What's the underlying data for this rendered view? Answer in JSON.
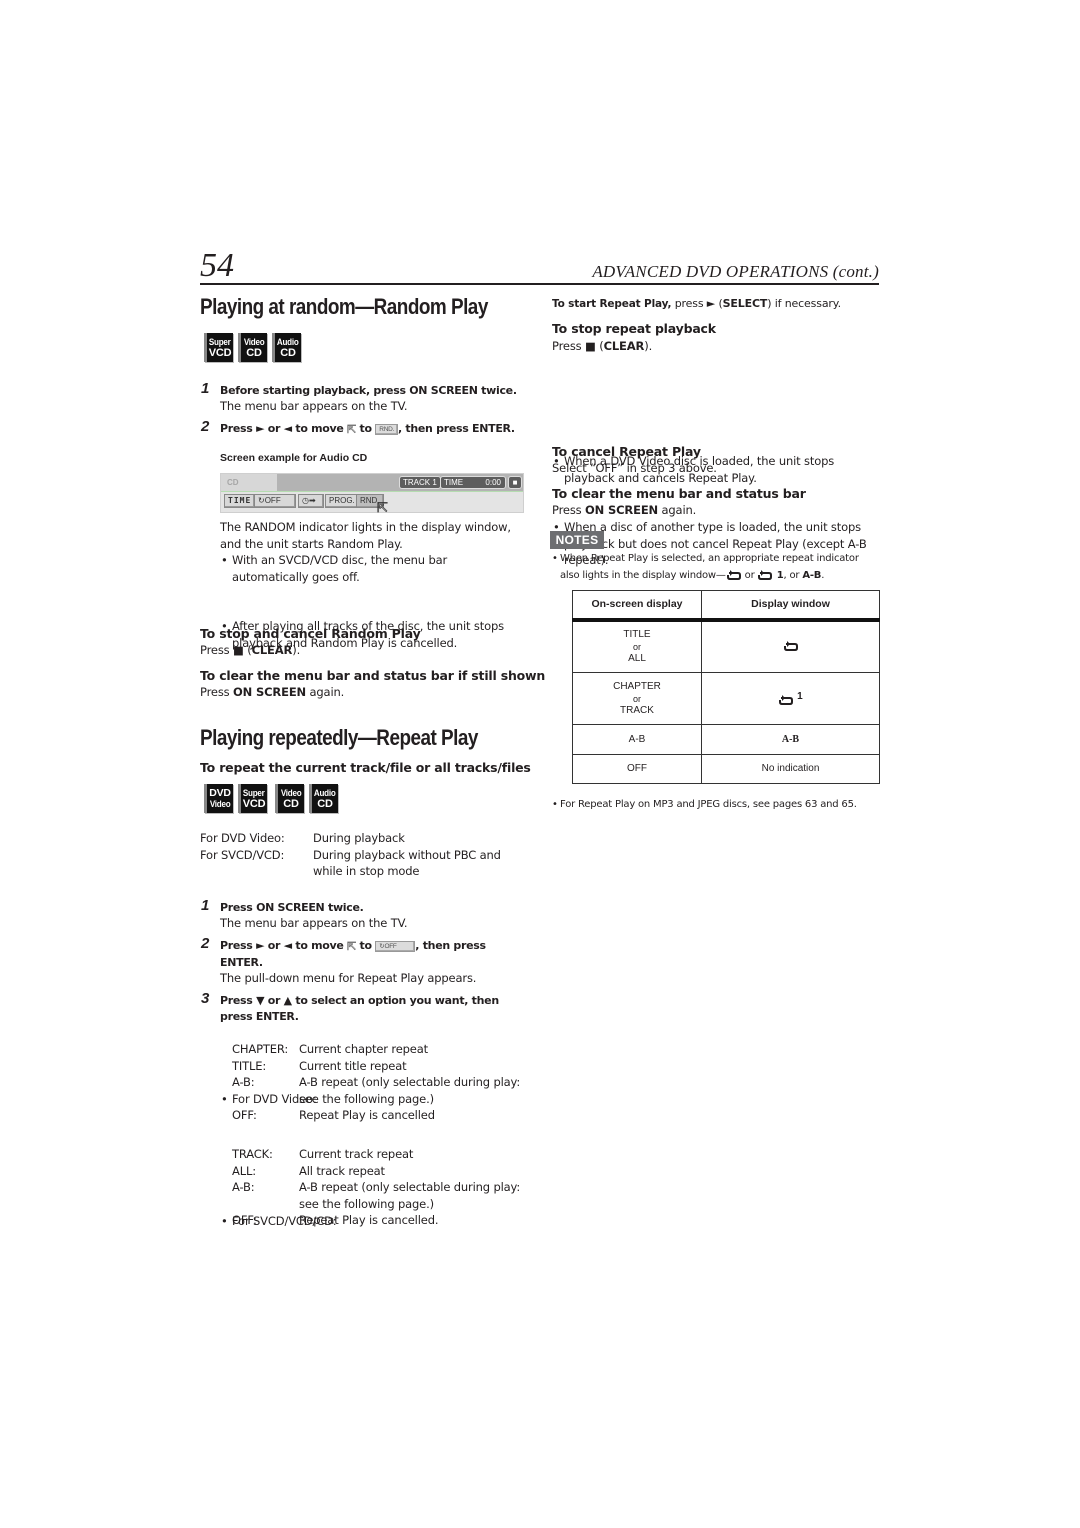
{
  "header": {
    "page_number": "54",
    "section_title": "ADVANCED DVD OPERATIONS (cont.)"
  },
  "random": {
    "title": "Playing at random—Random Play",
    "discs": [
      {
        "top": "Super",
        "bottom": "VCD"
      },
      {
        "top": "Video",
        "bottom": "CD"
      },
      {
        "top": "Audio",
        "bottom": "CD"
      }
    ],
    "step1": {
      "num": "1",
      "bold": "Before starting playback, press ON SCREEN twice.",
      "text": "The menu bar appears on the TV."
    },
    "step2": {
      "num": "2",
      "pre": "Press ► or ◄ to move",
      "mid": "to",
      "button": "RND.",
      "post": ", then press ENTER."
    },
    "screen_caption": "Screen example for Audio CD",
    "screen": {
      "disc_label": "CD",
      "track": "TRACK 1",
      "time_label": "TIME",
      "time_value": "0:00",
      "stop": "■",
      "buttons": [
        "TIME",
        "OFF",
        "PROG.",
        "RND."
      ]
    },
    "result": "The RANDOM indicator lights in the display window, and the unit starts Random Play.",
    "bullets": [
      "With an SVCD/VCD disc, the menu bar automatically goes off.",
      "After playing all tracks of the disc, the unit stops playback and Random Play is cancelled."
    ],
    "stop_heading": "To stop and cancel Random Play",
    "stop_pre": "Press ■ (",
    "stop_bold": "CLEAR",
    "stop_post": ").",
    "clear_heading": "To clear the menu bar and status bar if still shown",
    "clear_pre": "Press ",
    "clear_bold": "ON SCREEN",
    "clear_post": " again."
  },
  "repeat": {
    "title": "Playing repeatedly—Repeat Play",
    "subheading": "To repeat the current track/file or all tracks/files",
    "discs": [
      {
        "top": "DVD",
        "bottom": "Video"
      },
      {
        "top": "Super",
        "bottom": "VCD"
      },
      {
        "top": "Video",
        "bottom": "CD"
      },
      {
        "top": "Audio",
        "bottom": "CD"
      }
    ],
    "conditions": [
      {
        "label": "For DVD Video:",
        "value": "During playback"
      },
      {
        "label": "For SVCD/VCD:",
        "value": "During playback without PBC and while in stop mode"
      }
    ],
    "step1": {
      "num": "1",
      "bold": "Press ON SCREEN twice.",
      "text": "The menu bar appears on the TV."
    },
    "step2": {
      "num": "2",
      "pre": "Press ► or ◄ to move",
      "mid": "to",
      "button": "OFF",
      "post": ", then press",
      "post2": "ENTER.",
      "text": "The pull-down menu for Repeat Play appears."
    },
    "step3": {
      "num": "3",
      "bold1": "Press ▼ or ▲ to select an option you want, then",
      "bold2": "press ENTER."
    },
    "dvd_options_label": "For DVD Video:",
    "dvd_options": [
      {
        "key": "CHAPTER:",
        "value": "Current chapter repeat"
      },
      {
        "key": "TITLE:",
        "value": "Current title repeat"
      },
      {
        "key": "A-B:",
        "value": "A-B repeat (only selectable during play: see the following page.)"
      },
      {
        "key": "OFF:",
        "value": "Repeat Play is cancelled"
      }
    ],
    "cd_options_label": "For SVCD/VCD/CD:",
    "cd_options": [
      {
        "key": "TRACK:",
        "value": "Current track repeat"
      },
      {
        "key": "ALL:",
        "value": "All track repeat"
      },
      {
        "key": "A-B:",
        "value": "A-B repeat (only selectable during play: see the following page.)"
      },
      {
        "key": "OFF:",
        "value": "Repeat Play is cancelled."
      }
    ]
  },
  "right": {
    "start_bold": "To start Repeat Play,",
    "start_pre": " press ► (",
    "start_select": "SELECT",
    "start_post": ") if necessary.",
    "stop_heading": "To stop repeat playback",
    "stop_pre": "Press ■ (",
    "stop_bold": "CLEAR",
    "stop_post": ").",
    "stop_bullets": [
      "When a DVD Video disc is loaded, the unit stops playback and cancels Repeat Play.",
      "When a disc of another type is loaded, the unit stops playback but does not cancel Repeat Play (except A-B repeat)."
    ],
    "cancel_heading": "To cancel Repeat Play",
    "cancel_text": "Select “OFF” in step 3 above.",
    "clear_heading": "To clear the menu bar and status bar",
    "clear_pre": "Press ",
    "clear_bold": "ON SCREEN",
    "clear_post": " again.",
    "notes_label": "NOTES",
    "note1_a": "When Repeat Play is selected, an appropriate repeat indicator",
    "note1_b": "also lights in the display window—",
    "note1_or": " or ",
    "note1_one": " 1",
    "note1_sep": ", or ",
    "note1_ab": "A-B",
    "note1_end": ".",
    "table": {
      "headers": [
        "On-screen display",
        "Display window"
      ],
      "rows": [
        {
          "screen": [
            "TITLE",
            "or",
            "ALL"
          ],
          "window_icon": "repeat-icon",
          "window_text": ""
        },
        {
          "screen": [
            "CHAPTER",
            "or",
            "TRACK"
          ],
          "window_icon": "repeat-icon",
          "window_text": "1"
        },
        {
          "screen": [
            "A-B"
          ],
          "window_icon": "",
          "window_text": "A-B"
        },
        {
          "screen": [
            "OFF"
          ],
          "window_icon": "",
          "window_text": "No indication"
        }
      ]
    },
    "note2": "For Repeat Play on MP3 and JPEG discs, see pages 63 and 65."
  }
}
